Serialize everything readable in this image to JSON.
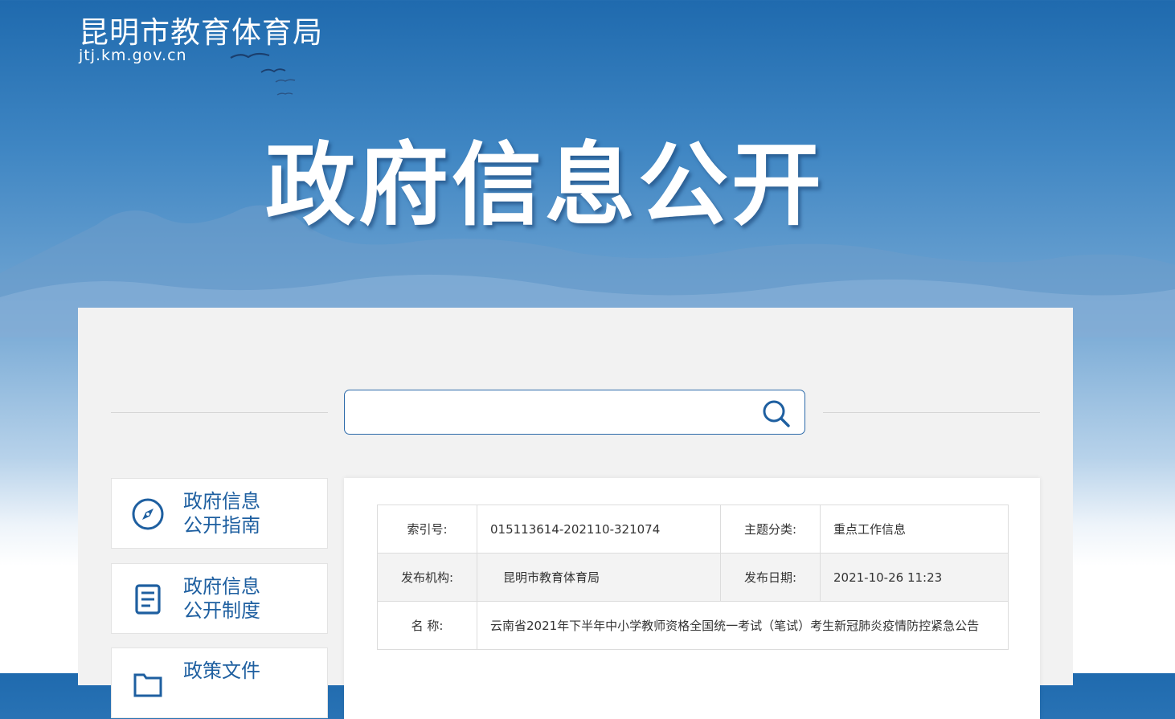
{
  "header": {
    "site_title": "昆明市教育体育局",
    "site_domain": "jtj.km.gov.cn",
    "hero_title": "政府信息公开"
  },
  "search": {
    "value": "",
    "placeholder": ""
  },
  "sidebar": {
    "items": [
      {
        "label_line1": "政府信息",
        "label_line2": "公开指南",
        "icon": "compass-icon"
      },
      {
        "label_line1": "政府信息",
        "label_line2": "公开制度",
        "icon": "document-icon"
      },
      {
        "label_line1": "政策文件",
        "label_line2": "",
        "icon": "folder-icon"
      }
    ]
  },
  "metadata": {
    "index_label": "索引号:",
    "index_value": "015113614-202110-321074",
    "category_label": "主题分类:",
    "category_value": "重点工作信息",
    "publisher_label": "发布机构:",
    "publisher_value": "昆明市教育体育局",
    "date_label": "发布日期:",
    "date_value": "2021-10-26 11:23",
    "name_label": "名 称:",
    "name_value": "云南省2021年下半年中小学教师资格全国统一考试（笔试）考生新冠肺炎疫情防控紧急公告"
  },
  "colors": {
    "brand_blue": "#1e5fa0",
    "border_blue": "#2c6aa9",
    "panel_bg": "#f2f2f2"
  }
}
